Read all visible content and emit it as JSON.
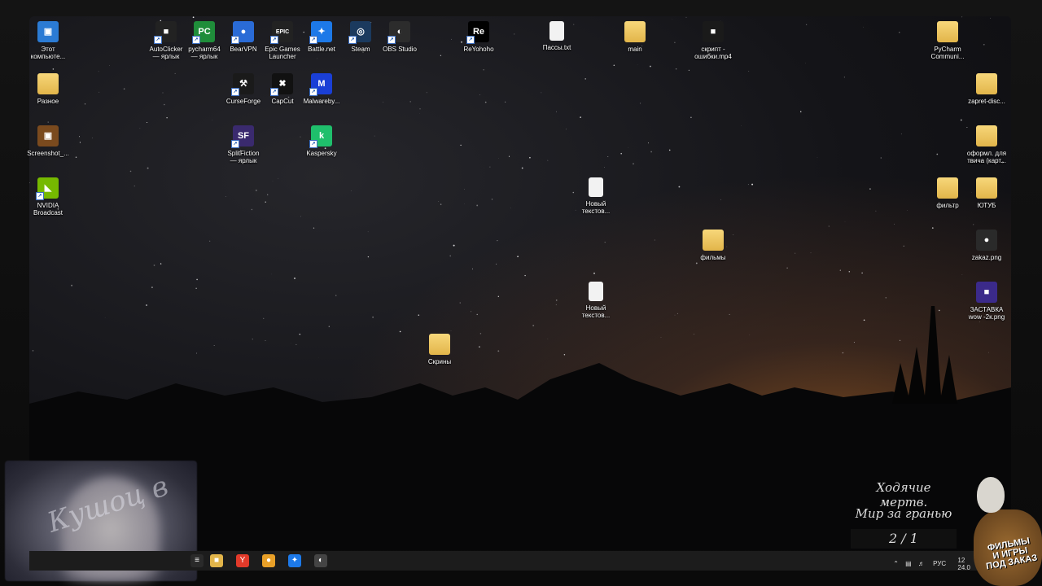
{
  "desktop": {
    "icons": [
      {
        "key": "this_pc",
        "label": "Этот\nкомпьюте...",
        "glyph": "▣",
        "color": "#2b7bd4"
      },
      {
        "key": "autoclicker",
        "label": "AutoClicker\n— ярлык",
        "glyph": "■",
        "color": "#222"
      },
      {
        "key": "pycharm64",
        "label": "pycharm64\n— ярлык",
        "glyph": "PC",
        "color": "#1f8d3a"
      },
      {
        "key": "bearvpn",
        "label": "BearVPN",
        "glyph": "●",
        "color": "#2a6bd6"
      },
      {
        "key": "epic",
        "label": "Epic Games\nLauncher",
        "glyph": "EPIC",
        "color": "#222"
      },
      {
        "key": "battlenet",
        "label": "Battle.net",
        "glyph": "✦",
        "color": "#1d79e8"
      },
      {
        "key": "steam",
        "label": "Steam",
        "glyph": "◎",
        "color": "#1b3a5e"
      },
      {
        "key": "obs",
        "label": "OBS Studio",
        "glyph": "◐",
        "color": "#2c2c2c"
      },
      {
        "key": "reyohoho",
        "label": "ReYohoho",
        "glyph": "Re",
        "color": "#000"
      },
      {
        "key": "passy",
        "label": "Пассы.txt",
        "glyph": "",
        "color": "#f2f2f2"
      },
      {
        "key": "main",
        "label": "main",
        "glyph": "",
        "color": "#e2b54a"
      },
      {
        "key": "script",
        "label": "скрипт -\nошибки.mp4",
        "glyph": "■",
        "color": "#1a1a1a"
      },
      {
        "key": "pycharm_comm",
        "label": "PyCharm\nCommuni...",
        "glyph": "",
        "color": "#e2b54a"
      },
      {
        "key": "raznoe",
        "label": "Разное",
        "glyph": "",
        "color": "#e2b54a"
      },
      {
        "key": "curseforge",
        "label": "CurseForge",
        "glyph": "⚒",
        "color": "#1a1a1a"
      },
      {
        "key": "capcut",
        "label": "CapCut",
        "glyph": "✖",
        "color": "#111"
      },
      {
        "key": "malwarebytes",
        "label": "Malwareby...",
        "glyph": "M",
        "color": "#1a3fd6"
      },
      {
        "key": "zapret",
        "label": "zapret-disc...",
        "glyph": "",
        "color": "#e2b54a"
      },
      {
        "key": "screenshot",
        "label": "Screenshot_...",
        "glyph": "▣",
        "color": "#7a4a1e"
      },
      {
        "key": "splitfiction",
        "label": "SplitFiction\n— ярлык",
        "glyph": "SF",
        "color": "#3a2a6e"
      },
      {
        "key": "kaspersky",
        "label": "Kaspersky",
        "glyph": "k",
        "color": "#1fbf6c"
      },
      {
        "key": "oformlenie",
        "label": "оформл. для\nтвича (карт...",
        "glyph": "",
        "color": "#e2b54a"
      },
      {
        "key": "nvidia",
        "label": "NVIDIA\nBroadcast",
        "glyph": "◣",
        "color": "#76b900"
      },
      {
        "key": "new_text1",
        "label": "Новый\nтекстов...",
        "glyph": "",
        "color": "#f2f2f2"
      },
      {
        "key": "filtr",
        "label": "фильтр",
        "glyph": "",
        "color": "#e2b54a"
      },
      {
        "key": "yutub",
        "label": "ЮТУБ",
        "glyph": "",
        "color": "#e2b54a"
      },
      {
        "key": "filmy",
        "label": "фильмы",
        "glyph": "",
        "color": "#e2b54a"
      },
      {
        "key": "zakaz",
        "label": "zakaz.png",
        "glyph": "●",
        "color": "#2a2a2a"
      },
      {
        "key": "new_text2",
        "label": "Новый\nтекстов...",
        "glyph": "",
        "color": "#f2f2f2"
      },
      {
        "key": "zastavka",
        "label": "ЗАСТАВКА\nwow -2к.png",
        "glyph": "■",
        "color": "#3b2a8a"
      },
      {
        "key": "skriny",
        "label": "Скрины",
        "glyph": "",
        "color": "#e2b54a"
      }
    ]
  },
  "webcam": {
    "overlay_text": "Кушоц в"
  },
  "now_playing": {
    "line1": "Ходячие мертв.",
    "line2": "Мир за гранью",
    "counter": "2 / 1"
  },
  "sticker": {
    "text": "ФИЛЬМЫ\nИ ИГРЫ\nПОД ЗАКАЗ"
  },
  "taskbar": {
    "apps": [
      {
        "key": "task_view",
        "glyph": "≡",
        "color": "#2a2a2a"
      },
      {
        "key": "explorer",
        "glyph": "■",
        "color": "#e2b54a"
      },
      {
        "key": "yandex",
        "glyph": "Y",
        "color": "#e23a2a"
      },
      {
        "key": "chrome",
        "glyph": "●",
        "color": "#e8a028"
      },
      {
        "key": "battlenet",
        "glyph": "✦",
        "color": "#1d79e8"
      },
      {
        "key": "obs",
        "glyph": "◐",
        "color": "#444"
      }
    ],
    "language": "РУС",
    "time": "12",
    "date": "24.0"
  }
}
